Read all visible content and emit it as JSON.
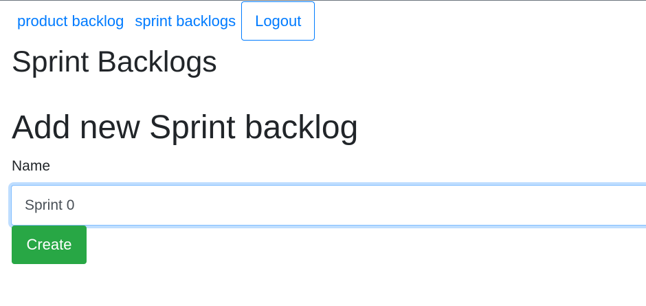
{
  "nav": {
    "links": [
      {
        "label": "product backlog"
      },
      {
        "label": "sprint backlogs"
      }
    ],
    "logout_label": "Logout"
  },
  "page": {
    "title": "Sprint Backlogs"
  },
  "form": {
    "heading": "Add new Sprint backlog",
    "name_label": "Name",
    "name_value": "Sprint 0",
    "submit_label": "Create"
  },
  "colors": {
    "link": "#007bff",
    "create_button": "#28a745",
    "text": "#212529",
    "input_focus_border": "#80bdff"
  }
}
